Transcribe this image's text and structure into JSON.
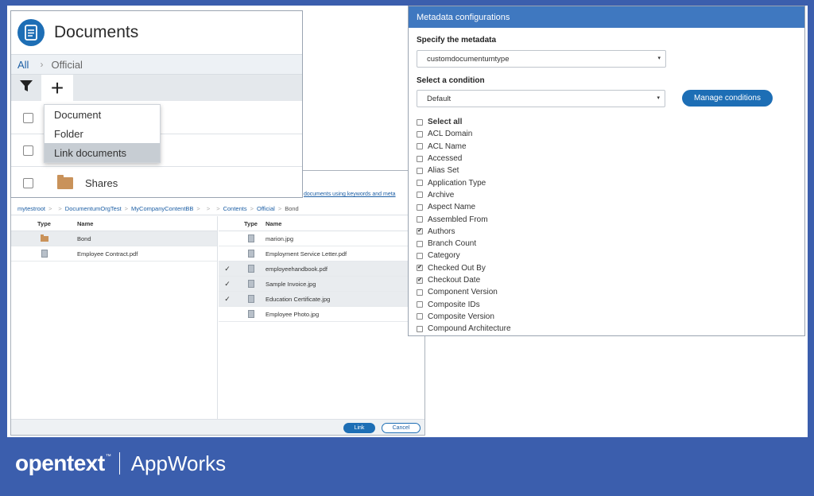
{
  "documents": {
    "title": "Documents",
    "breadcrumb": {
      "all": "All",
      "separator": "›",
      "current": "Official"
    },
    "toolbar": {
      "add_label": "+"
    },
    "add_menu": [
      "Document",
      "Folder",
      "Link documents"
    ],
    "rows": [
      {
        "name": "Shares"
      }
    ]
  },
  "link_dialog": {
    "search_link": "documents using keywords and meta",
    "path": [
      "mytestroot",
      ">",
      ">",
      "DocumentumOrgTest",
      ">",
      "MyCompanyContentBB",
      ">",
      ">",
      ">",
      "Contents",
      ">",
      "Official",
      ">",
      "Bond"
    ],
    "left": {
      "headers": {
        "type": "Type",
        "name": "Name"
      },
      "items": [
        {
          "name": "Bond",
          "icon": "folder-icon"
        },
        {
          "name": "Employee Contract.pdf",
          "icon": "file-icon"
        }
      ]
    },
    "right": {
      "headers": {
        "type": "Type",
        "name": "Name"
      },
      "items": [
        {
          "name": "marion.jpg",
          "checked": false
        },
        {
          "name": "Employment Service Letter.pdf",
          "checked": false
        },
        {
          "name": "employeehandbook.pdf",
          "checked": true
        },
        {
          "name": "Sample Invoice.jpg",
          "checked": true
        },
        {
          "name": "Education Certificate.jpg",
          "checked": true
        },
        {
          "name": "Employee Photo.jpg",
          "checked": false
        }
      ],
      "check_mark": "✓"
    },
    "link_button": "Link",
    "cancel_button": "Cancel"
  },
  "metadata": {
    "title": "Metadata configurations",
    "specify_label": "Specify the metadata",
    "specify_value": "customdocumentumtype",
    "condition_label": "Select a condition",
    "condition_value": "Default",
    "manage_button": "Manage conditions",
    "caret": "▾",
    "select_all": "Select all",
    "attributes": [
      {
        "label": "ACL Domain",
        "checked": false
      },
      {
        "label": "ACL Name",
        "checked": false
      },
      {
        "label": "Accessed",
        "checked": false
      },
      {
        "label": "Alias Set",
        "checked": false
      },
      {
        "label": "Application Type",
        "checked": false
      },
      {
        "label": "Archive",
        "checked": false
      },
      {
        "label": "Aspect Name",
        "checked": false
      },
      {
        "label": "Assembled From",
        "checked": false
      },
      {
        "label": "Authors",
        "checked": true
      },
      {
        "label": "Branch Count",
        "checked": false
      },
      {
        "label": "Category",
        "checked": false
      },
      {
        "label": "Checked Out By",
        "checked": true
      },
      {
        "label": "Checkout Date",
        "checked": true
      },
      {
        "label": "Component Version",
        "checked": false
      },
      {
        "label": "Composite IDs",
        "checked": false
      },
      {
        "label": "Composite Version",
        "checked": false
      },
      {
        "label": "Compound Architecture",
        "checked": false
      }
    ]
  },
  "brand": {
    "name": "opentext",
    "tm": "™",
    "product": "AppWorks"
  },
  "colors": {
    "accent": "#1d6eb5",
    "header": "#3f78c0",
    "background": "#3b5ead",
    "folder": "#c9925a"
  }
}
